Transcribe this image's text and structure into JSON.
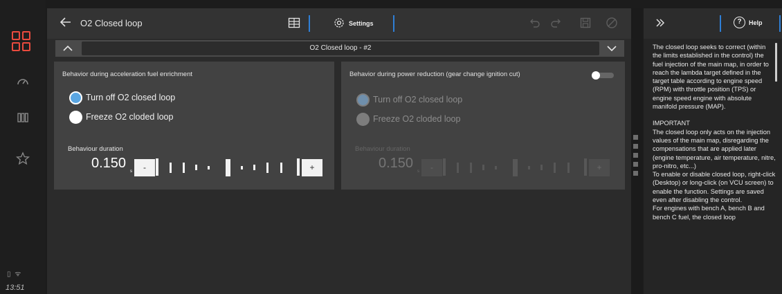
{
  "window": {
    "title": "O2 Closed loop",
    "settings_label": "Settings"
  },
  "selector": {
    "value": "O2 Closed loop - #2"
  },
  "left_card": {
    "heading": "Behavior during acceleration fuel enrichment",
    "options": [
      {
        "label": "Turn off O2 closed loop",
        "selected": true
      },
      {
        "label": "Freeze O2 cloded loop",
        "selected": false
      }
    ],
    "duration": {
      "label": "Behaviour duration",
      "value": "0.150",
      "unit": "s",
      "minus": "-",
      "plus": "+"
    }
  },
  "right_card": {
    "heading": "Behavior during power reduction (gear change ignition cut)",
    "toggle_on": false,
    "options": [
      {
        "label": "Turn off O2 closed loop",
        "selected": true
      },
      {
        "label": "Freeze O2 cloded loop",
        "selected": false
      }
    ],
    "duration": {
      "label": "Behaviour duration",
      "value": "0.150",
      "unit": "s",
      "minus": "-",
      "plus": "+"
    }
  },
  "help": {
    "button_label": "Help",
    "paragraph1": "The closed loop seeks to correct (within the limits established in the control) the fuel injection of the main map, in order to reach the lambda target defined in the target table according to engine speed (RPM) with throttle position (TPS) or engine speed engine with absolute manifold pressure (MAP).",
    "important_title": "IMPORTANT",
    "paragraph2": "The closed loop only acts on the injection values of the main map, disregarding the compensations that are applied later (engine temperature, air temperature, nitre, pro-nitro, etc...)",
    "paragraph3": "To enable or disable closed loop, right-click (Desktop) or long-click (on VCU screen) to enable the function. Settings are saved even after disabling the control.",
    "paragraph4": "For engines with bench A, bench B and bench C fuel, the closed loop"
  },
  "status": {
    "clock": "13:51"
  },
  "colors": {
    "accent": "#2f7fd6",
    "brand": "#ea4b3e",
    "radio_selected": "#5aa6e2"
  },
  "icons": {
    "back": "arrow-left-icon",
    "table": "table-icon",
    "settings": "gear-icon",
    "undo": "undo-icon",
    "redo": "redo-icon",
    "save": "save-icon",
    "disable": "block-icon",
    "expand": "double-chevron-right-icon",
    "help": "question-circle-icon"
  }
}
